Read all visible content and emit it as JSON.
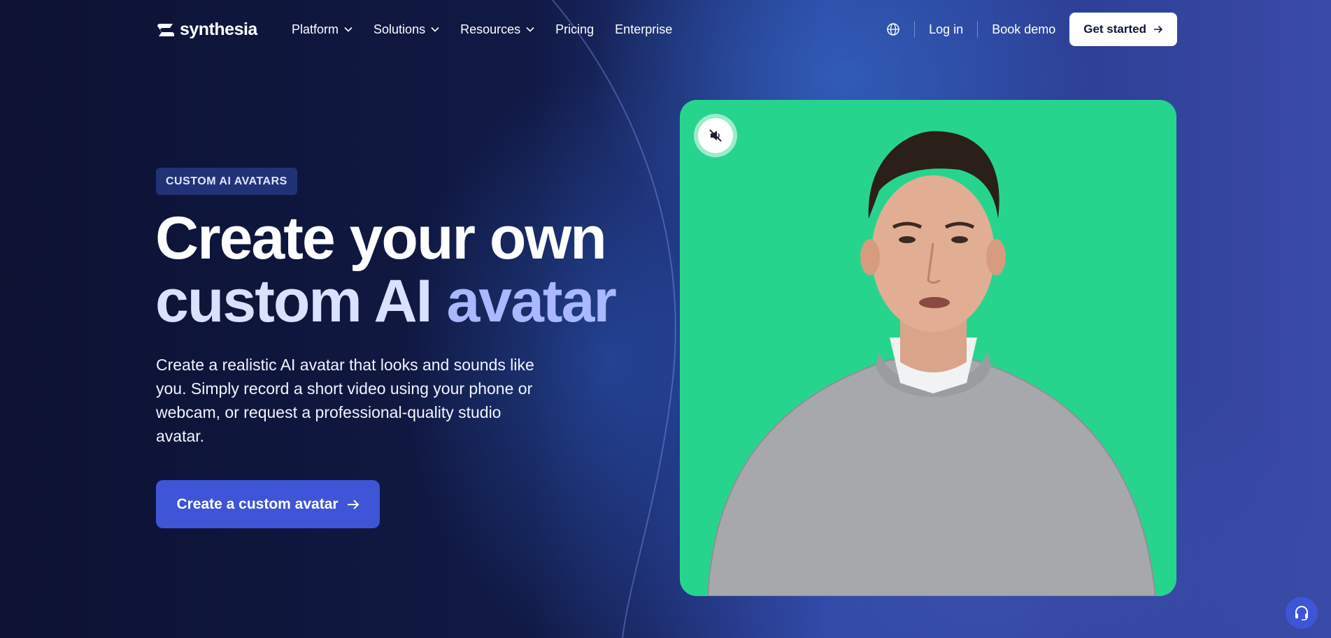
{
  "nav": {
    "logo_text": "synthesia",
    "menu": [
      {
        "label": "Platform",
        "has_dropdown": true
      },
      {
        "label": "Solutions",
        "has_dropdown": true
      },
      {
        "label": "Resources",
        "has_dropdown": true
      },
      {
        "label": "Pricing",
        "has_dropdown": false
      },
      {
        "label": "Enterprise",
        "has_dropdown": false
      }
    ],
    "login_label": "Log in",
    "book_demo_label": "Book demo",
    "get_started_label": "Get started"
  },
  "hero": {
    "badge": "CUSTOM AI AVATARS",
    "headline_line1": "Create your own",
    "headline_line2_a": "custom AI",
    "headline_line2_b": "avatar",
    "description": "Create a realistic AI avatar that looks and sounds like you. Simply record a short video using your phone or webcam, or request a professional-quality studio avatar.",
    "cta_label": "Create a custom avatar"
  },
  "video": {
    "muted": true,
    "background_color": "#27d48e"
  },
  "colors": {
    "accent": "#3d55d6",
    "headline_accent": "#a9b8ff",
    "video_bg": "#27d48e"
  },
  "icons": {
    "globe": "globe-icon",
    "mute": "speaker-muted-icon",
    "support": "headset-icon"
  }
}
